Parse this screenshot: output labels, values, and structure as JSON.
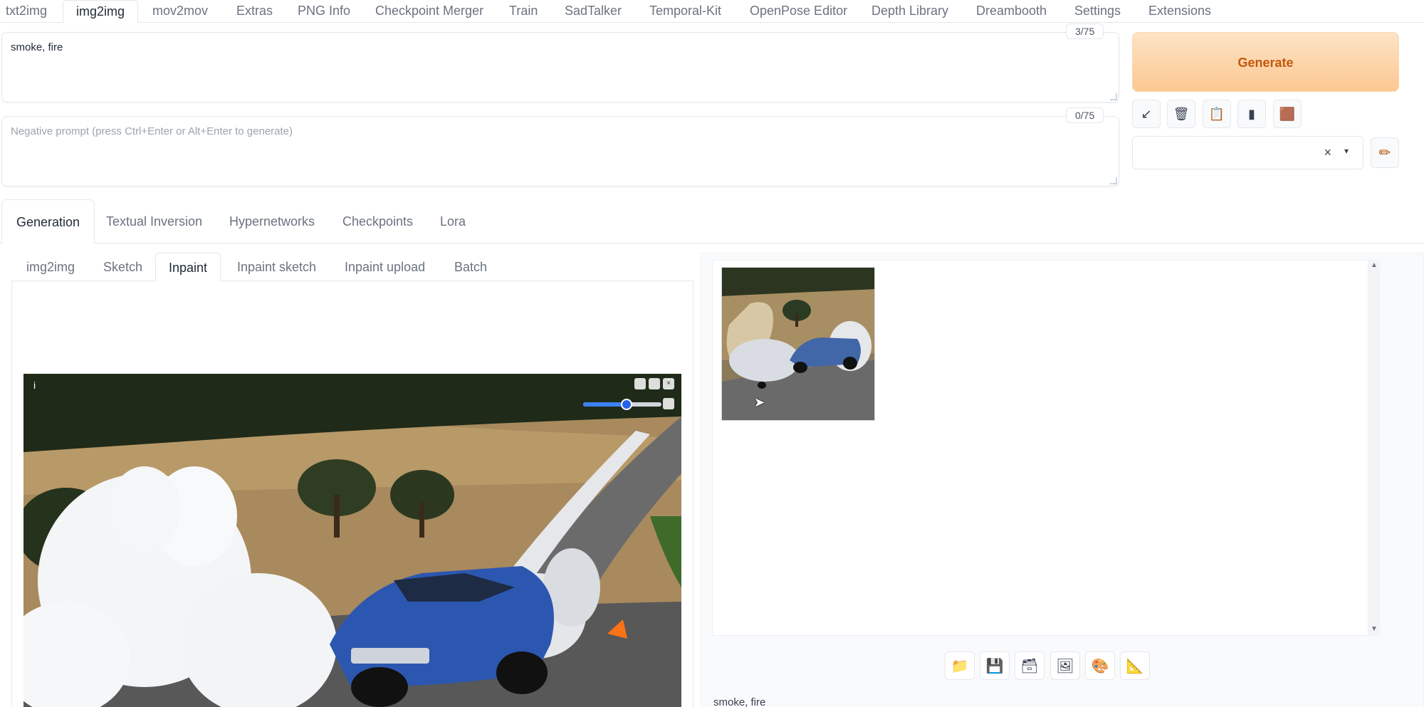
{
  "top_tabs": [
    "txt2img",
    "img2img",
    "mov2mov",
    "Extras",
    "PNG Info",
    "Checkpoint Merger",
    "Train",
    "SadTalker",
    "Temporal-Kit",
    "OpenPose Editor",
    "Depth Library",
    "Dreambooth",
    "Settings",
    "Extensions"
  ],
  "top_tabs_active": "img2img",
  "prompt": {
    "value": "smoke, fire",
    "token_count": "3/75"
  },
  "negative_prompt": {
    "placeholder": "Negative prompt (press Ctrl+Enter or Alt+Enter to generate)",
    "token_count": "0/75"
  },
  "generate": {
    "label": "Generate"
  },
  "tool_buttons": [
    {
      "icon": "arrow-diagonal-icon",
      "glyph": "↙"
    },
    {
      "icon": "trash-icon",
      "glyph": "🗑"
    },
    {
      "icon": "clipboard-icon",
      "glyph": "📋"
    },
    {
      "icon": "usb-icon",
      "glyph": "▮"
    },
    {
      "icon": "box-icon",
      "glyph": "🟫"
    }
  ],
  "styles": {
    "clear_glyph": "×",
    "caret_glyph": "▾",
    "edit_glyph": "✏"
  },
  "gen_tabs": [
    "Generation",
    "Textual Inversion",
    "Hypernetworks",
    "Checkpoints",
    "Lora"
  ],
  "gen_tabs_active": "Generation",
  "sub_tabs": [
    "img2img",
    "Sketch",
    "Inpaint",
    "Inpaint sketch",
    "Inpaint upload",
    "Batch"
  ],
  "sub_tabs_active": "Inpaint",
  "canvas": {
    "info_glyph": "i",
    "brush_size_fraction": 0.55
  },
  "output_buttons": [
    {
      "icon": "folder-icon",
      "glyph": "📁"
    },
    {
      "icon": "save-icon",
      "glyph": "💾"
    },
    {
      "icon": "zip-icon",
      "glyph": "🗃"
    },
    {
      "icon": "image-icon",
      "glyph": "🖼"
    },
    {
      "icon": "palette-icon",
      "glyph": "🎨"
    },
    {
      "icon": "ruler-icon",
      "glyph": "📐"
    }
  ],
  "output_info": "smoke, fire"
}
